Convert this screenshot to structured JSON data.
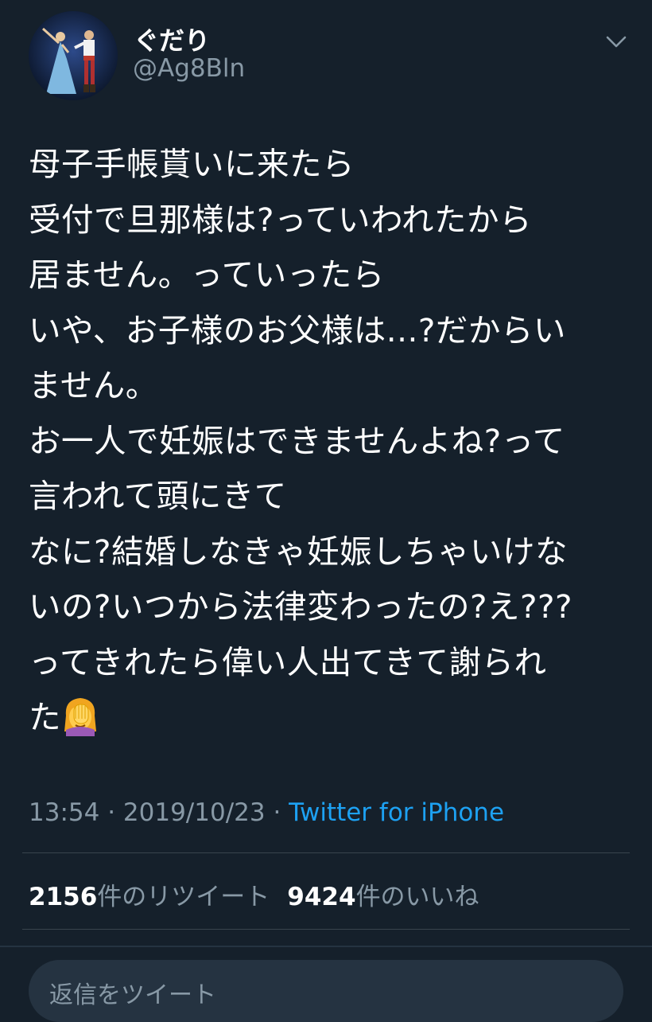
{
  "author": {
    "display_name": "ぐだり",
    "handle": "@Ag8Bln"
  },
  "tweet": {
    "text": "母子手帳貰いに来たら\n受付で旦那様は?っていわれたから\n居ません。っていったら\nいや、お子様のお父様は...?だからい\nません。\nお一人で妊娠はできませんよね?って\n言われて頭にきて\nなに?結婚しなきゃ妊娠しちゃいけな\nいの?いつから法律変わったの?え???\nってきれたら偉い人出てきて謝られ\nた",
    "emoji": "face-palming-woman-emoji"
  },
  "meta": {
    "time": "13:54",
    "separator": " · ",
    "date": "2019/10/23",
    "source": "Twitter for iPhone"
  },
  "stats": {
    "retweet_count": "2156",
    "retweet_label": "件のリツイート",
    "like_count": "9424",
    "like_label": "件のいいね"
  },
  "reply": {
    "placeholder": "返信をツイート"
  },
  "colors": {
    "background": "#15202b",
    "secondary_text": "#8899a6",
    "link": "#1da1f2",
    "divider": "#38444d"
  }
}
